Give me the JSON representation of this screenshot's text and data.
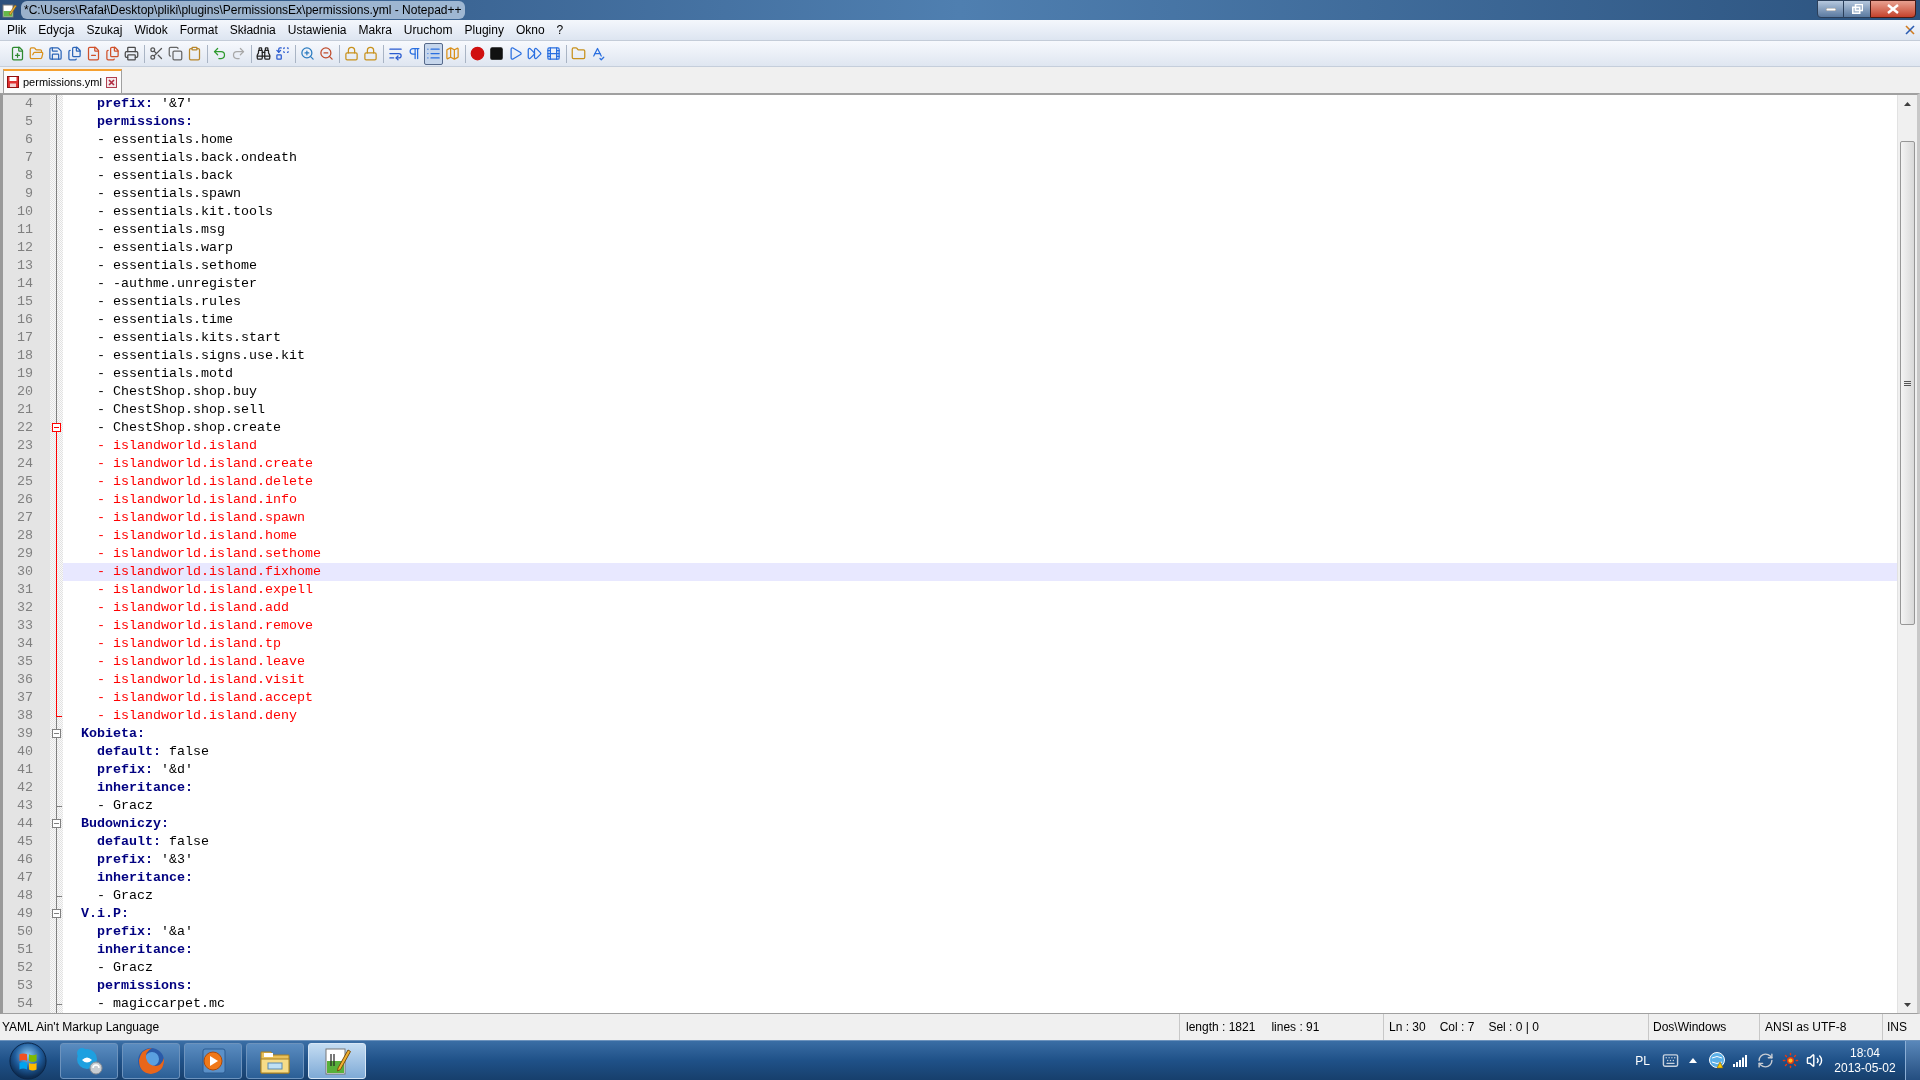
{
  "window": {
    "title": "*C:\\Users\\Rafał\\Desktop\\pliki\\plugins\\PermissionsEx\\permissions.yml - Notepad++"
  },
  "menu": [
    "Plik",
    "Edycja",
    "Szukaj",
    "Widok",
    "Format",
    "Składnia",
    "Ustawienia",
    "Makra",
    "Uruchom",
    "Pluginy",
    "Okno",
    "?"
  ],
  "toolbar": [
    [
      {
        "kind": "new-file",
        "pressed": false,
        "disabled": false
      },
      {
        "kind": "open-file",
        "pressed": false,
        "disabled": false
      },
      {
        "kind": "save",
        "pressed": false,
        "disabled": false
      },
      {
        "kind": "save-all",
        "pressed": false,
        "disabled": false
      },
      {
        "kind": "close",
        "pressed": false,
        "disabled": false
      },
      {
        "kind": "close-all",
        "pressed": false,
        "disabled": false
      },
      {
        "kind": "print",
        "pressed": false,
        "disabled": false
      }
    ],
    [
      {
        "kind": "cut",
        "pressed": false,
        "disabled": false
      },
      {
        "kind": "copy",
        "pressed": false,
        "disabled": false
      },
      {
        "kind": "paste",
        "pressed": false,
        "disabled": false
      }
    ],
    [
      {
        "kind": "undo",
        "pressed": false,
        "disabled": false
      },
      {
        "kind": "redo",
        "pressed": false,
        "disabled": true
      }
    ],
    [
      {
        "kind": "find",
        "pressed": false,
        "disabled": false
      },
      {
        "kind": "replace",
        "pressed": false,
        "disabled": false
      }
    ],
    [
      {
        "kind": "zoom-in",
        "pressed": false,
        "disabled": false
      },
      {
        "kind": "zoom-out",
        "pressed": false,
        "disabled": false
      }
    ],
    [
      {
        "kind": "sync-vertical",
        "pressed": false,
        "disabled": false
      },
      {
        "kind": "sync-horizontal",
        "pressed": false,
        "disabled": false
      }
    ],
    [
      {
        "kind": "word-wrap",
        "pressed": false,
        "disabled": false
      },
      {
        "kind": "show-symbols",
        "pressed": false,
        "disabled": false
      },
      {
        "kind": "indent-guide",
        "pressed": true,
        "disabled": false
      },
      {
        "kind": "document-map",
        "pressed": false,
        "disabled": false
      }
    ],
    [
      {
        "kind": "record",
        "pressed": false,
        "disabled": false
      },
      {
        "kind": "stop",
        "pressed": false,
        "disabled": false
      },
      {
        "kind": "play",
        "pressed": false,
        "disabled": false
      },
      {
        "kind": "play-multiple",
        "pressed": false,
        "disabled": false
      },
      {
        "kind": "save-macro",
        "pressed": false,
        "disabled": false
      }
    ],
    [
      {
        "kind": "open-folder",
        "pressed": false,
        "disabled": false
      },
      {
        "kind": "spell-check",
        "pressed": false,
        "disabled": false
      }
    ]
  ],
  "tabs": [
    {
      "label": "permissions.yml",
      "selected": true,
      "modified": true
    }
  ],
  "editor": {
    "lines": [
      {
        "number": "4",
        "kind": "key",
        "key": "    prefix:",
        "value": "'&7'",
        "selected": false
      },
      {
        "number": "5",
        "kind": "key",
        "key": "    permissions:",
        "selected": false
      },
      {
        "number": "6",
        "kind": "item",
        "text": "    - essentials.home",
        "selected": false
      },
      {
        "number": "7",
        "kind": "item",
        "text": "    - essentials.back.ondeath",
        "selected": false
      },
      {
        "number": "8",
        "kind": "item",
        "text": "    - essentials.back",
        "selected": false
      },
      {
        "number": "9",
        "kind": "item",
        "text": "    - essentials.spawn",
        "selected": false
      },
      {
        "number": "10",
        "kind": "item",
        "text": "    - essentials.kit.tools",
        "selected": false
      },
      {
        "number": "11",
        "kind": "item",
        "text": "    - essentials.msg",
        "selected": false
      },
      {
        "number": "12",
        "kind": "item",
        "text": "    - essentials.warp",
        "selected": false
      },
      {
        "number": "13",
        "kind": "item",
        "text": "    - essentials.sethome",
        "selected": false
      },
      {
        "number": "14",
        "kind": "item",
        "text": "    - -authme.unregister",
        "selected": false
      },
      {
        "number": "15",
        "kind": "item",
        "text": "    - essentials.rules",
        "selected": false
      },
      {
        "number": "16",
        "kind": "item",
        "text": "    - essentials.time",
        "selected": false
      },
      {
        "number": "17",
        "kind": "item",
        "text": "    - essentials.kits.start",
        "selected": false
      },
      {
        "number": "18",
        "kind": "item",
        "text": "    - essentials.signs.use.kit",
        "selected": false
      },
      {
        "number": "19",
        "kind": "item",
        "text": "    - essentials.motd",
        "selected": false
      },
      {
        "number": "20",
        "kind": "item",
        "text": "    - ChestShop.shop.buy",
        "selected": false
      },
      {
        "number": "21",
        "kind": "item",
        "text": "    - ChestShop.shop.sell",
        "selected": false
      },
      {
        "number": "22",
        "kind": "item",
        "text": "    - ChestShop.shop.create",
        "selected": false,
        "expanded": true,
        "children": [
          {
            "number": "23",
            "kind": "error",
            "text": "    - islandworld.island",
            "selected": false
          },
          {
            "number": "24",
            "kind": "error",
            "text": "    - islandworld.island.create",
            "selected": false
          },
          {
            "number": "25",
            "kind": "error",
            "text": "    - islandworld.island.delete",
            "selected": false
          },
          {
            "number": "26",
            "kind": "error",
            "text": "    - islandworld.island.info",
            "selected": false
          },
          {
            "number": "27",
            "kind": "error",
            "text": "    - islandworld.island.spawn",
            "selected": false
          },
          {
            "number": "28",
            "kind": "error",
            "text": "    - islandworld.island.home",
            "selected": false
          },
          {
            "number": "29",
            "kind": "error",
            "text": "    - islandworld.island.sethome",
            "selected": false
          },
          {
            "number": "30",
            "kind": "error",
            "text": "    - islandworld.island.fixhome",
            "selected": true
          },
          {
            "number": "31",
            "kind": "error",
            "text": "    - islandworld.island.expell",
            "selected": false
          },
          {
            "number": "32",
            "kind": "error",
            "text": "    - islandworld.island.add",
            "selected": false
          },
          {
            "number": "33",
            "kind": "error",
            "text": "    - islandworld.island.remove",
            "selected": false
          },
          {
            "number": "34",
            "kind": "error",
            "text": "    - islandworld.island.tp",
            "selected": false
          },
          {
            "number": "35",
            "kind": "error",
            "text": "    - islandworld.island.leave",
            "selected": false
          },
          {
            "number": "36",
            "kind": "error",
            "text": "    - islandworld.island.visit",
            "selected": false
          },
          {
            "number": "37",
            "kind": "error",
            "text": "    - islandworld.island.accept",
            "selected": false
          },
          {
            "number": "38",
            "kind": "error",
            "text": "    - islandworld.island.deny",
            "selected": false
          }
        ]
      },
      {
        "number": "39",
        "kind": "key",
        "key": "  Kobieta:",
        "selected": false,
        "expanded": true,
        "children": [
          {
            "number": "40",
            "kind": "key",
            "key": "    default:",
            "value": "false",
            "selected": false
          },
          {
            "number": "41",
            "kind": "key",
            "key": "    prefix:",
            "value": "'&d'",
            "selected": false
          },
          {
            "number": "42",
            "kind": "key",
            "key": "    inheritance:",
            "selected": false
          },
          {
            "number": "43",
            "kind": "item",
            "text": "    - Gracz",
            "selected": false
          }
        ]
      },
      {
        "number": "44",
        "kind": "key",
        "key": "  Budowniczy:",
        "selected": false,
        "expanded": true,
        "children": [
          {
            "number": "45",
            "kind": "key",
            "key": "    default:",
            "value": "false",
            "selected": false
          },
          {
            "number": "46",
            "kind": "key",
            "key": "    prefix:",
            "value": "'&3'",
            "selected": false
          },
          {
            "number": "47",
            "kind": "key",
            "key": "    inheritance:",
            "selected": false
          },
          {
            "number": "48",
            "kind": "item",
            "text": "    - Gracz",
            "selected": false
          }
        ]
      },
      {
        "number": "49",
        "kind": "key",
        "key": "  V.i.P:",
        "selected": false,
        "expanded": true,
        "children": [
          {
            "number": "50",
            "kind": "key",
            "key": "    prefix:",
            "value": "'&a'",
            "selected": false
          },
          {
            "number": "51",
            "kind": "key",
            "key": "    inheritance:",
            "selected": false
          },
          {
            "number": "52",
            "kind": "item",
            "text": "    - Gracz",
            "selected": false
          },
          {
            "number": "53",
            "kind": "key",
            "key": "    permissions:",
            "selected": false
          },
          {
            "number": "54",
            "kind": "item",
            "text": "    - magiccarpet.mc",
            "selected": false
          }
        ]
      }
    ]
  },
  "status_bar": {
    "language": "YAML Ain't Markup Language",
    "length": "length : 1821",
    "lines": "lines : 91",
    "line": "Ln : 30",
    "column": "Col : 7",
    "selection": "Sel : 0 | 0",
    "eol": "Dos\\Windows",
    "encoding": "ANSI as UTF-8",
    "mode": "INS"
  },
  "taskbar": {
    "apps": [
      {
        "kind": "messenger",
        "selected": false
      },
      {
        "kind": "browser",
        "selected": false
      },
      {
        "kind": "media-player",
        "selected": false
      },
      {
        "kind": "file-manager",
        "selected": false
      },
      {
        "kind": "text-editor",
        "selected": true
      }
    ],
    "tray": {
      "language": "PL",
      "time": "18:04",
      "date": "2013-05-02"
    }
  }
}
